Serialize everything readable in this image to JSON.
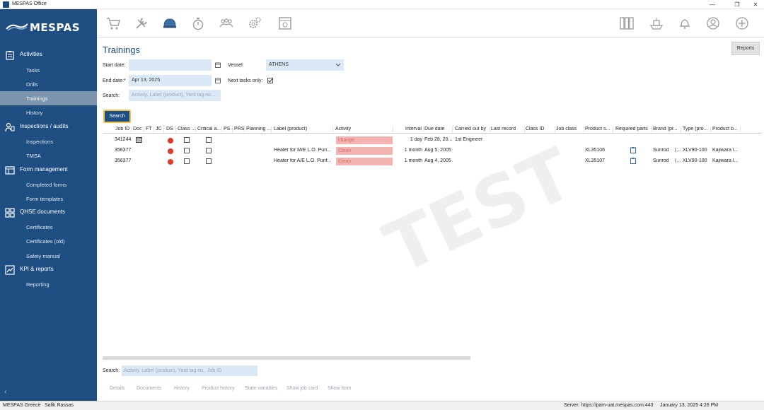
{
  "window": {
    "title": "MESPAS Office",
    "min": "—",
    "restore": "❐",
    "close": "✕"
  },
  "sidebar": {
    "logo_text": "MESPAS",
    "groups": [
      {
        "label": "Activities",
        "icon": "clipboard-icon",
        "items": [
          "Tasks",
          "Drills",
          "Trainings",
          "History"
        ]
      },
      {
        "label": "Inspections / audits",
        "icon": "inspector-icon",
        "items": [
          "Inspections",
          "TMSA"
        ]
      },
      {
        "label": "Form management",
        "icon": "form-icon",
        "items": [
          "Completed forms",
          "Form templates"
        ]
      },
      {
        "label": "QHSE documents",
        "icon": "documents-icon",
        "items": [
          "Certificates",
          "Certificates (old)",
          "Safety manual"
        ]
      },
      {
        "label": "KPI & reports",
        "icon": "chart-icon",
        "items": [
          "Reporting"
        ]
      }
    ],
    "active_item": "Trainings",
    "collapse": "‹"
  },
  "toolbar": {
    "left_icons": [
      "cart-icon",
      "tools-icon",
      "helmet-icon",
      "stopwatch-icon",
      "team-icon",
      "gears-icon",
      "document-settings-icon"
    ],
    "right_icons": [
      "binders-icon",
      "ship-icon",
      "bell-icon",
      "user-icon",
      "plus-icon"
    ]
  },
  "page": {
    "title": "Trainings",
    "reports_label": "Reports",
    "filters": {
      "start_date_label": "Start date:",
      "start_date_value": "",
      "end_date_label": "End date:*",
      "end_date_value": "Apr 13, 2025",
      "vessel_label": "Vessel:",
      "vessel_value": "ATHENS",
      "next_tasks_label": "Next tasks only:",
      "next_tasks_checked": true,
      "search_label": "Search:",
      "search_placeholder": "Activity, Label (product), Yard tag no...",
      "search_button": "Search"
    },
    "columns": [
      "Job ID",
      "Doc",
      "FT",
      "JC",
      "DS",
      "Class ...",
      "Critical a...",
      "PS",
      "PRS",
      "Planning ...",
      "Label (product)",
      "Activity",
      "Interval",
      "Due date",
      "Carried out by",
      "Last record",
      "Class ID",
      "Job class",
      "Product s...",
      "Required parts",
      "Brand (pr...",
      "Type (pro...",
      "Product b..."
    ],
    "rows": [
      {
        "job_id": "341244",
        "doc": "calendar",
        "label": "",
        "activity": "change",
        "interval": "1 day",
        "due": "Feb 28, 20...",
        "carried": "1st Engineer",
        "product_s": "",
        "brand": "",
        "brand2": "",
        "type": "",
        "product_b": ""
      },
      {
        "job_id": "356377",
        "doc": "",
        "label": "Heater for M/E L.O. Puri...",
        "activity": "Clean",
        "interval": "1 month",
        "due": "Aug 5, 2005",
        "carried": "",
        "product_s": "XL35106",
        "brand": "Sunrod",
        "brand2": "(...",
        "type": "XLV90-100",
        "product_b": "Kajiwara I..."
      },
      {
        "job_id": "356377",
        "doc": "",
        "label": "Heater for A/E L.O. Purif...",
        "activity": "Clean",
        "interval": "1 month",
        "due": "Aug 4, 2005",
        "carried": "",
        "product_s": "XL35107",
        "brand": "Sunrod",
        "brand2": "(...",
        "type": "XLV90-100",
        "product_b": "Kajiwara I..."
      }
    ],
    "watermark": "TEST",
    "bottom_search_label": "Search:",
    "bottom_search_placeholder": "Activity, Label (product), Yard tag no., Job ID",
    "bottom_tabs": [
      "Details",
      "Documents",
      "History",
      "Product history",
      "State variables",
      "Show job card",
      "Show form"
    ]
  },
  "status": {
    "company": "MESPAS Greece",
    "user": "Safik Rassas",
    "server": "Server: https://pam-uat.mespas.com:443",
    "datetime": "January 13, 2025 4:26 PM"
  }
}
